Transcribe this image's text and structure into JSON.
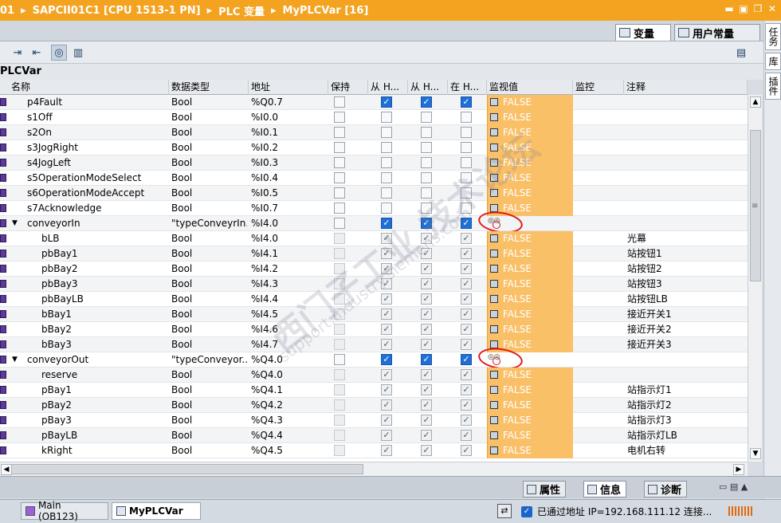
{
  "titlebar": {
    "crumbs": [
      "01",
      "SAPCII01C1 [CPU 1513-1 PN]",
      "PLC 变量",
      "MyPLCVar [16]"
    ],
    "sep": "▸",
    "win_btns": [
      "▬",
      "▣",
      "❐",
      "✕"
    ]
  },
  "taskstrip": {
    "tabs": [
      "任务",
      "库",
      "插件"
    ]
  },
  "editor_tabs": [
    {
      "label": "变量",
      "active": true
    },
    {
      "label": "用户常量",
      "active": false
    }
  ],
  "toolbar": {
    "icons": [
      "insert-row-icon",
      "export-icon",
      "monitor-glasses-icon",
      "table-settings-icon"
    ],
    "right_icon": "window-split-icon"
  },
  "table": {
    "title": "PLCVar",
    "headers": [
      "名称",
      "数据类型",
      "地址",
      "保持",
      "从 H...",
      "从 H...",
      "在 H...",
      "监视值",
      "监控",
      "注释"
    ],
    "rows": [
      {
        "name": "p4Fault",
        "type": "Bool",
        "addr": "%Q0.7",
        "level": 0,
        "mon": "FALSE",
        "comment": "",
        "c1": true,
        "c2": true,
        "c3": true,
        "style": "blue"
      },
      {
        "name": "s1Off",
        "type": "Bool",
        "addr": "%I0.0",
        "level": 0,
        "mon": "FALSE",
        "comment": "",
        "c1": false,
        "c2": false,
        "c3": false,
        "style": "blue"
      },
      {
        "name": "s2On",
        "type": "Bool",
        "addr": "%I0.1",
        "level": 0,
        "mon": "FALSE",
        "comment": "",
        "c1": false,
        "c2": false,
        "c3": false,
        "style": "blue"
      },
      {
        "name": "s3JogRight",
        "type": "Bool",
        "addr": "%I0.2",
        "level": 0,
        "mon": "FALSE",
        "comment": "",
        "c1": false,
        "c2": false,
        "c3": false,
        "style": "blue"
      },
      {
        "name": "s4JogLeft",
        "type": "Bool",
        "addr": "%I0.3",
        "level": 0,
        "mon": "FALSE",
        "comment": "",
        "c1": false,
        "c2": false,
        "c3": false,
        "style": "blue"
      },
      {
        "name": "s5OperationModeSelect",
        "type": "Bool",
        "addr": "%I0.4",
        "level": 0,
        "mon": "FALSE",
        "comment": "",
        "c1": false,
        "c2": false,
        "c3": false,
        "style": "blue"
      },
      {
        "name": "s6OperationModeAccept",
        "type": "Bool",
        "addr": "%I0.5",
        "level": 0,
        "mon": "FALSE",
        "comment": "",
        "c1": false,
        "c2": false,
        "c3": false,
        "style": "blue"
      },
      {
        "name": "s7Acknowledge",
        "type": "Bool",
        "addr": "%I0.7",
        "level": 0,
        "mon": "FALSE",
        "comment": "",
        "c1": false,
        "c2": false,
        "c3": false,
        "style": "blue"
      },
      {
        "name": "conveyorIn",
        "type": "\"typeConveyrIn...",
        "addr": "%I4.0",
        "level": 0,
        "mon": "",
        "comment": "",
        "c1": true,
        "c2": true,
        "c3": true,
        "style": "blue",
        "expand": true,
        "circle": true
      },
      {
        "name": "bLB",
        "type": "Bool",
        "addr": "%I4.0",
        "level": 1,
        "mon": "FALSE",
        "comment": "光幕",
        "c1": true,
        "c2": true,
        "c3": true,
        "style": "gray"
      },
      {
        "name": "pbBay1",
        "type": "Bool",
        "addr": "%I4.1",
        "level": 1,
        "mon": "FALSE",
        "comment": "站按钮1",
        "c1": true,
        "c2": true,
        "c3": true,
        "style": "gray"
      },
      {
        "name": "pbBay2",
        "type": "Bool",
        "addr": "%I4.2",
        "level": 1,
        "mon": "FALSE",
        "comment": "站按钮2",
        "c1": true,
        "c2": true,
        "c3": true,
        "style": "gray"
      },
      {
        "name": "pbBay3",
        "type": "Bool",
        "addr": "%I4.3",
        "level": 1,
        "mon": "FALSE",
        "comment": "站按钮3",
        "c1": true,
        "c2": true,
        "c3": true,
        "style": "gray"
      },
      {
        "name": "pbBayLB",
        "type": "Bool",
        "addr": "%I4.4",
        "level": 1,
        "mon": "FALSE",
        "comment": "站按钮LB",
        "c1": true,
        "c2": true,
        "c3": true,
        "style": "gray"
      },
      {
        "name": "bBay1",
        "type": "Bool",
        "addr": "%I4.5",
        "level": 1,
        "mon": "FALSE",
        "comment": "接近开关1",
        "c1": true,
        "c2": true,
        "c3": true,
        "style": "gray"
      },
      {
        "name": "bBay2",
        "type": "Bool",
        "addr": "%I4.6",
        "level": 1,
        "mon": "FALSE",
        "comment": "接近开关2",
        "c1": true,
        "c2": true,
        "c3": true,
        "style": "gray"
      },
      {
        "name": "bBay3",
        "type": "Bool",
        "addr": "%I4.7",
        "level": 1,
        "mon": "FALSE",
        "comment": "接近开关3",
        "c1": true,
        "c2": true,
        "c3": true,
        "style": "gray"
      },
      {
        "name": "conveyorOut",
        "type": "\"typeConveyor...",
        "addr": "%Q4.0",
        "level": 0,
        "mon": "",
        "comment": "",
        "c1": true,
        "c2": true,
        "c3": true,
        "style": "blue",
        "expand": true,
        "circle": true
      },
      {
        "name": "reserve",
        "type": "Bool",
        "addr": "%Q4.0",
        "level": 1,
        "mon": "FALSE",
        "comment": "",
        "c1": true,
        "c2": true,
        "c3": true,
        "style": "gray"
      },
      {
        "name": "pBay1",
        "type": "Bool",
        "addr": "%Q4.1",
        "level": 1,
        "mon": "FALSE",
        "comment": "站指示灯1",
        "c1": true,
        "c2": true,
        "c3": true,
        "style": "gray"
      },
      {
        "name": "pBay2",
        "type": "Bool",
        "addr": "%Q4.2",
        "level": 1,
        "mon": "FALSE",
        "comment": "站指示灯2",
        "c1": true,
        "c2": true,
        "c3": true,
        "style": "gray"
      },
      {
        "name": "pBay3",
        "type": "Bool",
        "addr": "%Q4.3",
        "level": 1,
        "mon": "FALSE",
        "comment": "站指示灯3",
        "c1": true,
        "c2": true,
        "c3": true,
        "style": "gray"
      },
      {
        "name": "pBayLB",
        "type": "Bool",
        "addr": "%Q4.4",
        "level": 1,
        "mon": "FALSE",
        "comment": "站指示灯LB",
        "c1": true,
        "c2": true,
        "c3": true,
        "style": "gray"
      },
      {
        "name": "kRight",
        "type": "Bool",
        "addr": "%Q4.5",
        "level": 1,
        "mon": "FALSE",
        "comment": "电机右转",
        "c1": true,
        "c2": true,
        "c3": true,
        "style": "gray"
      }
    ]
  },
  "prop_tabs": [
    {
      "label": "属性",
      "active": false
    },
    {
      "label": "信息",
      "active": true
    },
    {
      "label": "诊断",
      "active": false
    }
  ],
  "taskbar": {
    "items": [
      {
        "label": "Main (OB123)",
        "active": false
      },
      {
        "label": "MyPLCVar",
        "active": true
      }
    ],
    "status": "已通过地址 IP=192.168.111.12 连接..."
  },
  "watermark": {
    "line1": "西门子工业 技术论坛",
    "line2": "support.industry.siemens.com"
  },
  "colors": {
    "title": "#f4a321",
    "monitor": "#f9c068",
    "check_blue": "#1f6fd6",
    "annotation": "#e01a1a"
  }
}
